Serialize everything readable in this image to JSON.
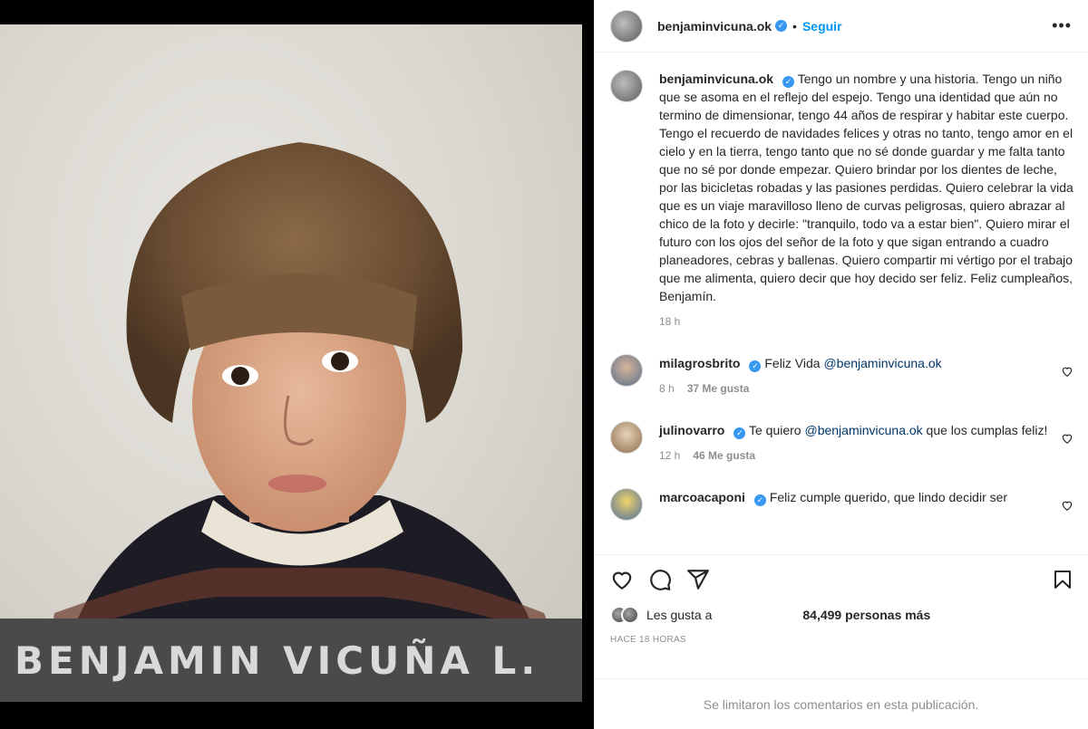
{
  "photo": {
    "nameplate_text": "BENJAMIN VICUÑA L."
  },
  "header": {
    "username": "benjaminvicuna.ok",
    "separator": "•",
    "follow_label": "Seguir",
    "more_label": "•••"
  },
  "caption": {
    "username": "benjaminvicuna.ok",
    "text": "Tengo un nombre y una historia. Tengo un niño que se asoma en el reflejo del espejo. Tengo una identidad que aún no termino de dimensionar, tengo 44 años de respirar y habitar este cuerpo. Tengo el recuerdo de navidades felices y otras no tanto, tengo amor en el cielo y en la tierra, tengo tanto que no sé donde guardar y me falta tanto que no sé por donde empezar. Quiero brindar por los dientes de leche, por las bicicletas robadas y las pasiones perdidas. Quiero celebrar la vida que es un viaje maravilloso lleno de curvas peligrosas, quiero abrazar al chico de la foto y decirle: \"tranquilo, todo va a estar bien\". Quiero mirar el futuro con los ojos del señor de la foto y que sigan entrando a cuadro planeadores, cebras y ballenas. Quiero compartir mi vértigo por el trabajo que me alimenta, quiero decir que hoy decido ser feliz. Feliz cumpleaños, Benjamín.",
    "time": "18 h"
  },
  "comments": [
    {
      "username": "milagrosbrito",
      "text_before": "Feliz Vida ",
      "mention": "@benjaminvicuna.ok",
      "text_after": "",
      "time": "8 h",
      "likes": "37 Me gusta"
    },
    {
      "username": "julinovarro",
      "text_before": "Te quiero ",
      "mention": "@benjaminvicuna.ok",
      "text_after": " que los cumplas feliz!",
      "time": "12 h",
      "likes": "46 Me gusta"
    },
    {
      "username": "marcoacaponi",
      "text_before": "Feliz cumple querido, que lindo decidir ser",
      "mention": "",
      "text_after": "",
      "time": "",
      "likes": ""
    }
  ],
  "likes": {
    "prefix": "Les gusta a",
    "count": "84,499 personas más"
  },
  "timestamp": "HACE 18 HORAS",
  "comments_limited": "Se limitaron los comentarios en esta publicación.",
  "icons": [
    "heart-icon",
    "comment-icon",
    "share-icon",
    "bookmark-icon",
    "verified-icon",
    "more-icon"
  ],
  "colors": {
    "accent": "#0095f6",
    "verified": "#3897f0",
    "muted": "#8e8e8e",
    "mention": "#00376b"
  }
}
